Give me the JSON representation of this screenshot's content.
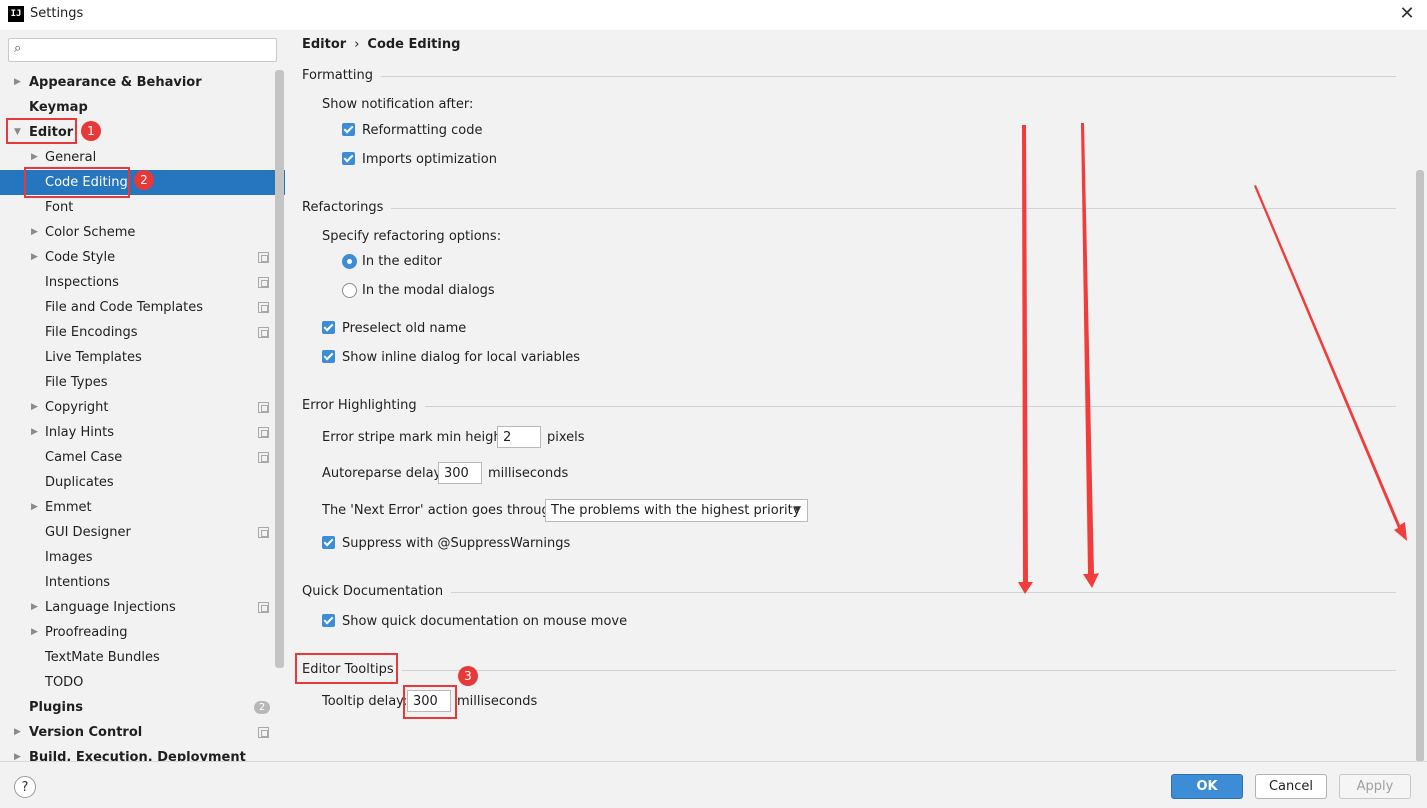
{
  "window": {
    "title": "Settings",
    "app_icon_text": "IJ",
    "close_glyph": "✕"
  },
  "search": {
    "placeholder": "",
    "icon_glyph": "⌕"
  },
  "sidebar": {
    "items": [
      {
        "label": "Appearance & Behavior",
        "arrow": "▶"
      },
      {
        "label": "Keymap"
      },
      {
        "label": "Editor",
        "arrow": "▼"
      },
      {
        "label": "General",
        "arrow": "▶"
      },
      {
        "label": "Code Editing"
      },
      {
        "label": "Font"
      },
      {
        "label": "Color Scheme",
        "arrow": "▶"
      },
      {
        "label": "Code Style",
        "arrow": "▶"
      },
      {
        "label": "Inspections"
      },
      {
        "label": "File and Code Templates"
      },
      {
        "label": "File Encodings"
      },
      {
        "label": "Live Templates"
      },
      {
        "label": "File Types"
      },
      {
        "label": "Copyright",
        "arrow": "▶"
      },
      {
        "label": "Inlay Hints",
        "arrow": "▶"
      },
      {
        "label": "Camel Case"
      },
      {
        "label": "Duplicates"
      },
      {
        "label": "Emmet",
        "arrow": "▶"
      },
      {
        "label": "GUI Designer"
      },
      {
        "label": "Images"
      },
      {
        "label": "Intentions"
      },
      {
        "label": "Language Injections",
        "arrow": "▶"
      },
      {
        "label": "Proofreading",
        "arrow": "▶"
      },
      {
        "label": "TextMate Bundles"
      },
      {
        "label": "TODO"
      },
      {
        "label": "Plugins",
        "badge": "2"
      },
      {
        "label": "Version Control",
        "arrow": "▶"
      },
      {
        "label": "Build, Execution, Deployment",
        "arrow": "▶"
      }
    ]
  },
  "breadcrumb": {
    "parent": "Editor",
    "separator": "›",
    "current": "Code Editing"
  },
  "formatting": {
    "title": "Formatting",
    "show_notification_label": "Show notification after:",
    "reformatting_code": "Reformatting code",
    "imports_optimization": "Imports optimization"
  },
  "refactorings": {
    "title": "Refactorings",
    "specify_label": "Specify refactoring options:",
    "in_editor": "In the editor",
    "in_modal": "In the modal dialogs",
    "preselect": "Preselect old name",
    "show_inline": "Show inline dialog for local variables"
  },
  "error_highlighting": {
    "title": "Error Highlighting",
    "stripe_label": "Error stripe mark min height:",
    "stripe_value": "2",
    "stripe_unit": "pixels",
    "autoreparse_label": "Autoreparse delay:",
    "autoreparse_value": "300",
    "autoreparse_unit": "milliseconds",
    "next_error_label": "The 'Next Error' action goes through:",
    "next_error_value": "The problems with the highest priority",
    "suppress": "Suppress with @SuppressWarnings"
  },
  "quick_documentation": {
    "title": "Quick Documentation",
    "show_on_mouse_move": "Show quick documentation on mouse move"
  },
  "editor_tooltips": {
    "title": "Editor Tooltips",
    "delay_label": "Tooltip delay:",
    "delay_value": "300",
    "delay_unit": "milliseconds"
  },
  "annotations": {
    "badge1": "1",
    "badge2": "2",
    "badge3": "3",
    "color": "#e63a3a"
  },
  "footer": {
    "help": "?",
    "ok": "OK",
    "cancel": "Cancel",
    "apply": "Apply"
  },
  "colors": {
    "selection": "#2675bf",
    "accent": "#3c8cd6",
    "annotation": "#e63a3a"
  }
}
